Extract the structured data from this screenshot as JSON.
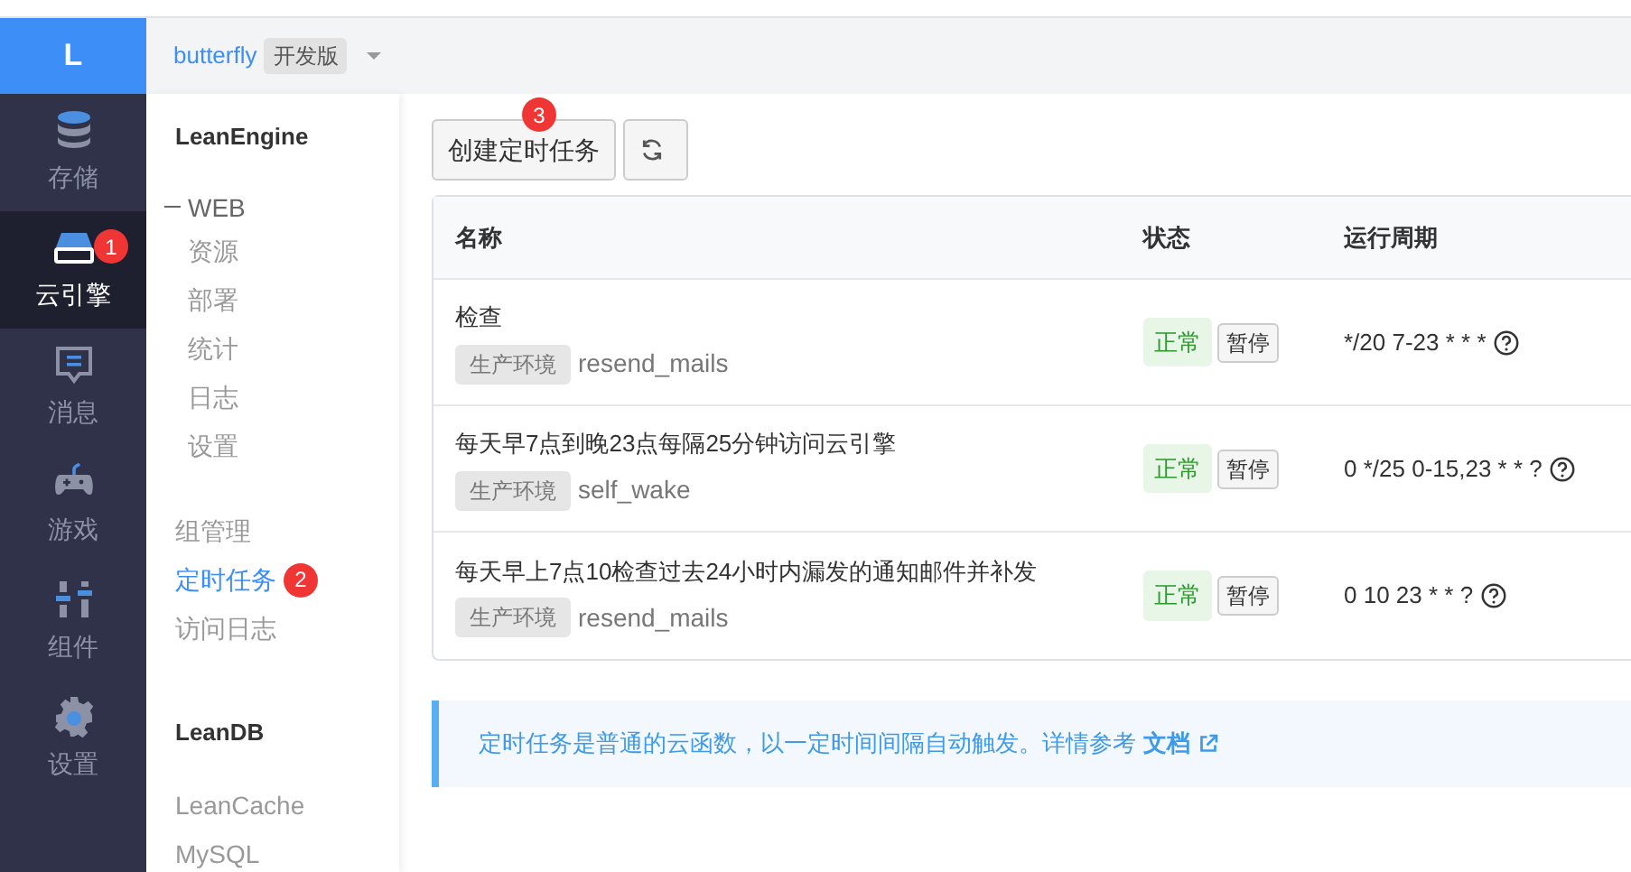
{
  "app_logo": "L",
  "project": {
    "name": "butterfly",
    "edition": "开发版"
  },
  "nav": [
    {
      "label": "存储",
      "kind": "database",
      "selected": false
    },
    {
      "label": "云引擎",
      "kind": "drive",
      "selected": true,
      "annotation": "1"
    },
    {
      "label": "消息",
      "kind": "message",
      "selected": false
    },
    {
      "label": "游戏",
      "kind": "gamepad",
      "selected": false
    },
    {
      "label": "组件",
      "kind": "sliders",
      "selected": false
    },
    {
      "label": "设置",
      "kind": "gear",
      "selected": false
    }
  ],
  "subnav": [
    {
      "title": "LeanEngine",
      "items": [
        {
          "label": "WEB",
          "expanded": true,
          "selected": false,
          "children": [
            {
              "label": "资源",
              "selected": false
            },
            {
              "label": "部署",
              "selected": false
            },
            {
              "label": "统计",
              "selected": false
            },
            {
              "label": "日志",
              "selected": false
            },
            {
              "label": "设置",
              "selected": false
            }
          ]
        },
        {
          "label": "组管理",
          "selected": false
        },
        {
          "label": "定时任务",
          "selected": true,
          "annotation": "2"
        },
        {
          "label": "访问日志",
          "selected": false
        }
      ]
    },
    {
      "title": "LeanDB",
      "items": [
        {
          "label": "LeanCache",
          "selected": false
        },
        {
          "label": "MySQL",
          "selected": false
        }
      ]
    }
  ],
  "toolbar": {
    "create_button": "创建定时任务",
    "annotation": "3"
  },
  "table": {
    "columns": [
      "名称",
      "状态",
      "运行周期"
    ],
    "rows": [
      {
        "name": "检查",
        "env": "生产环境",
        "function": "resend_mails",
        "status": "正常",
        "action": "暂停",
        "schedule": "*/20 7-23 * * *"
      },
      {
        "name": "每天早7点到晚23点每隔25分钟访问云引擎",
        "env": "生产环境",
        "function": "self_wake",
        "status": "正常",
        "action": "暂停",
        "schedule": "0 */25 0-15,23 * * ?"
      },
      {
        "name": "每天早上7点10检查过去24小时内漏发的通知邮件并补发",
        "env": "生产环境",
        "function": "resend_mails",
        "status": "正常",
        "action": "暂停",
        "schedule": "0 10 23 * * ?"
      }
    ]
  },
  "info": {
    "text": "定时任务是普通的云函数，以一定时间间隔自动触发。详情参考",
    "link": "文档"
  }
}
